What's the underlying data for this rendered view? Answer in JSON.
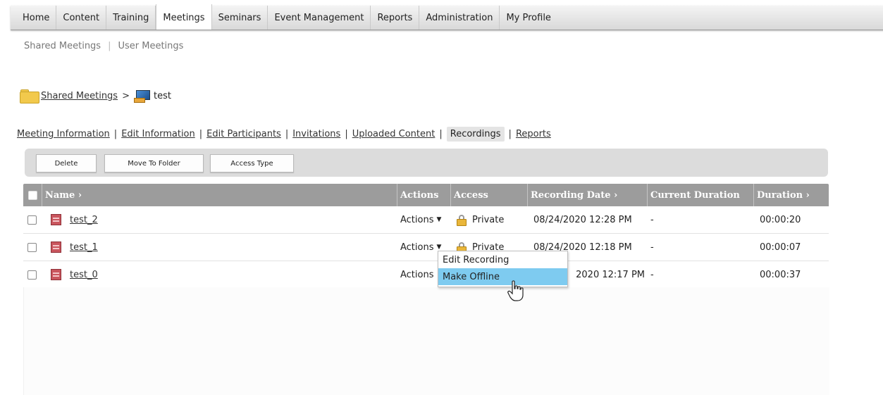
{
  "topnav": {
    "tabs": [
      {
        "label": "Home"
      },
      {
        "label": "Content"
      },
      {
        "label": "Training"
      },
      {
        "label": "Meetings",
        "active": true
      },
      {
        "label": "Seminars"
      },
      {
        "label": "Event Management"
      },
      {
        "label": "Reports"
      },
      {
        "label": "Administration"
      },
      {
        "label": "My Profile"
      }
    ]
  },
  "subnav": {
    "items": [
      "Shared Meetings",
      "User Meetings"
    ],
    "separator": "|"
  },
  "breadcrumb": {
    "folder_link": "Shared Meetings",
    "separator": ">",
    "current": "test",
    "folder_icon": "folder-icon",
    "meeting_icon": "meeting-icon"
  },
  "sublinks": {
    "items": [
      "Meeting Information",
      "Edit Information",
      "Edit Participants",
      "Invitations",
      "Uploaded Content",
      "Recordings",
      "Reports"
    ],
    "current": "Recordings",
    "separator": "|"
  },
  "toolbar": {
    "delete_label": "Delete",
    "move_label": "Move To Folder",
    "access_label": "Access Type"
  },
  "table": {
    "headers": {
      "name": "Name ›",
      "actions": "Actions",
      "access": "Access",
      "recording_date": "Recording Date ›",
      "current_duration": "Current Duration",
      "duration": "Duration ›"
    },
    "rows": [
      {
        "name": "test_2",
        "actions": "Actions",
        "access": "Private",
        "recording_date": "08/24/2020 12:28 PM",
        "current_duration": "-",
        "duration": "00:00:20"
      },
      {
        "name": "test_1",
        "actions": "Actions",
        "access": "Private",
        "recording_date": "08/24/2020 12:18 PM",
        "current_duration": "-",
        "duration": "00:00:07"
      },
      {
        "name": "test_0",
        "actions": "Actions",
        "access": "",
        "recording_date": "2020 12:17 PM",
        "current_duration": "-",
        "duration": "00:00:37"
      }
    ]
  },
  "actions_menu": {
    "items": [
      "Edit Recording",
      "Make Offline"
    ],
    "highlighted": "Make Offline"
  },
  "colors": {
    "header_bg": "#9c9c9c",
    "menu_highlight": "#7ecbf0",
    "toolbar_bg": "#dcdcdc"
  }
}
